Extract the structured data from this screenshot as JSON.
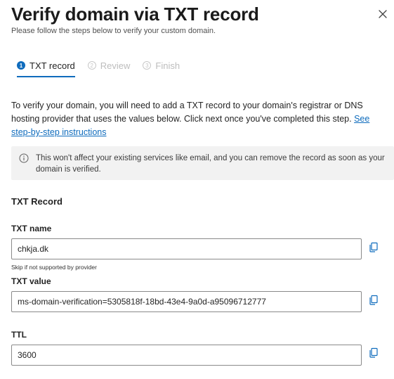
{
  "dialog": {
    "title": "Verify domain via TXT record",
    "subtitle": "Please follow the steps below to verify your custom domain.",
    "close_icon": "close-icon"
  },
  "steps": [
    {
      "number": "1",
      "label": "TXT record",
      "state": "active"
    },
    {
      "number": "2",
      "label": "Review",
      "state": "disabled"
    },
    {
      "number": "3",
      "label": "Finish",
      "state": "disabled"
    }
  ],
  "instructions": {
    "text": "To verify your domain, you will need to add a TXT record to your domain's registrar or DNS hosting provider that uses the values below. Click next once you've completed this step. ",
    "link": "See step-by-step instructions"
  },
  "info_banner": {
    "icon": "info-icon",
    "text": "This won't affect your existing services like email, and you can remove the record as soon as your domain is verified."
  },
  "section_title": "TXT Record",
  "fields": {
    "txt_name": {
      "label": "TXT name",
      "value": "chkja.dk",
      "hint": "Skip if not supported by provider"
    },
    "txt_value": {
      "label": "TXT value",
      "value": "ms-domain-verification=5305818f-18bd-43e4-9a0d-a95096712777"
    },
    "ttl": {
      "label": "TTL",
      "value": "3600"
    }
  },
  "colors": {
    "accent": "#0f6cbd",
    "banner_bg": "#f2f2f2"
  }
}
